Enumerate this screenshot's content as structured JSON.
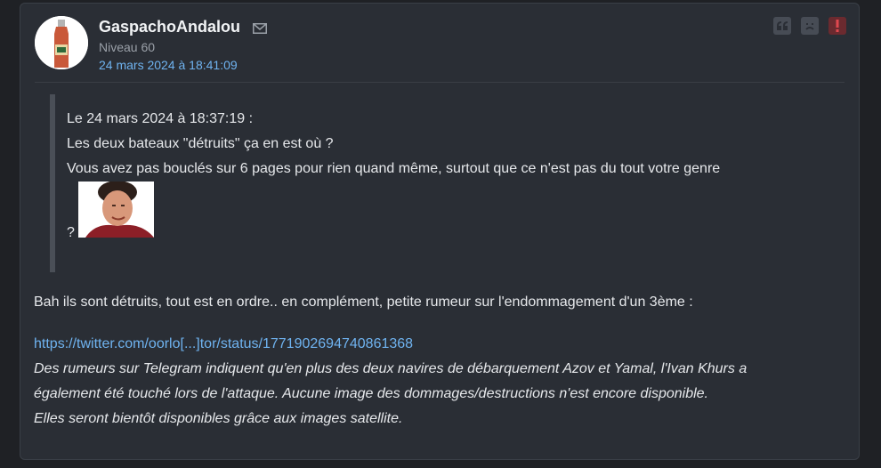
{
  "post": {
    "author": "GaspachoAndalou",
    "level": "Niveau 60",
    "date": "24 mars 2024 à 18:41:09",
    "icons": {
      "mail": "envelope-icon",
      "quote": "quote-icon",
      "sad": "sad-face-icon",
      "alert": "exclamation-icon"
    },
    "quote": {
      "header": "Le 24 mars 2024 à 18:37:19 :",
      "line1": "Les deux bateaux \"détruits\" ça en est où ?",
      "line2": "Vous avez pas bouclés sur 6 pages pour rien quand même, surtout que ce n'est pas du tout votre genre",
      "qmark": "?"
    },
    "message": {
      "text": "Bah ils sont détruits, tout est en ordre.. en complément, petite rumeur sur l'endommagement d'un 3ème :",
      "link": "https://twitter.com/oorlo[...]tor/status/1771902694740861368",
      "italic_lines": [
        "Des rumeurs sur Telegram indiquent qu'en plus des deux navires de débarquement Azov et Yamal, l'Ivan Khurs a",
        "également été touché lors de l'attaque. Aucune image des dommages/destructions n'est encore disponible.",
        "Elles seront bientôt disponibles grâce aux images satellite."
      ]
    },
    "colors": {
      "link": "#6fb3f0",
      "background": "#2a2e35",
      "alert": "#c0393f"
    }
  }
}
